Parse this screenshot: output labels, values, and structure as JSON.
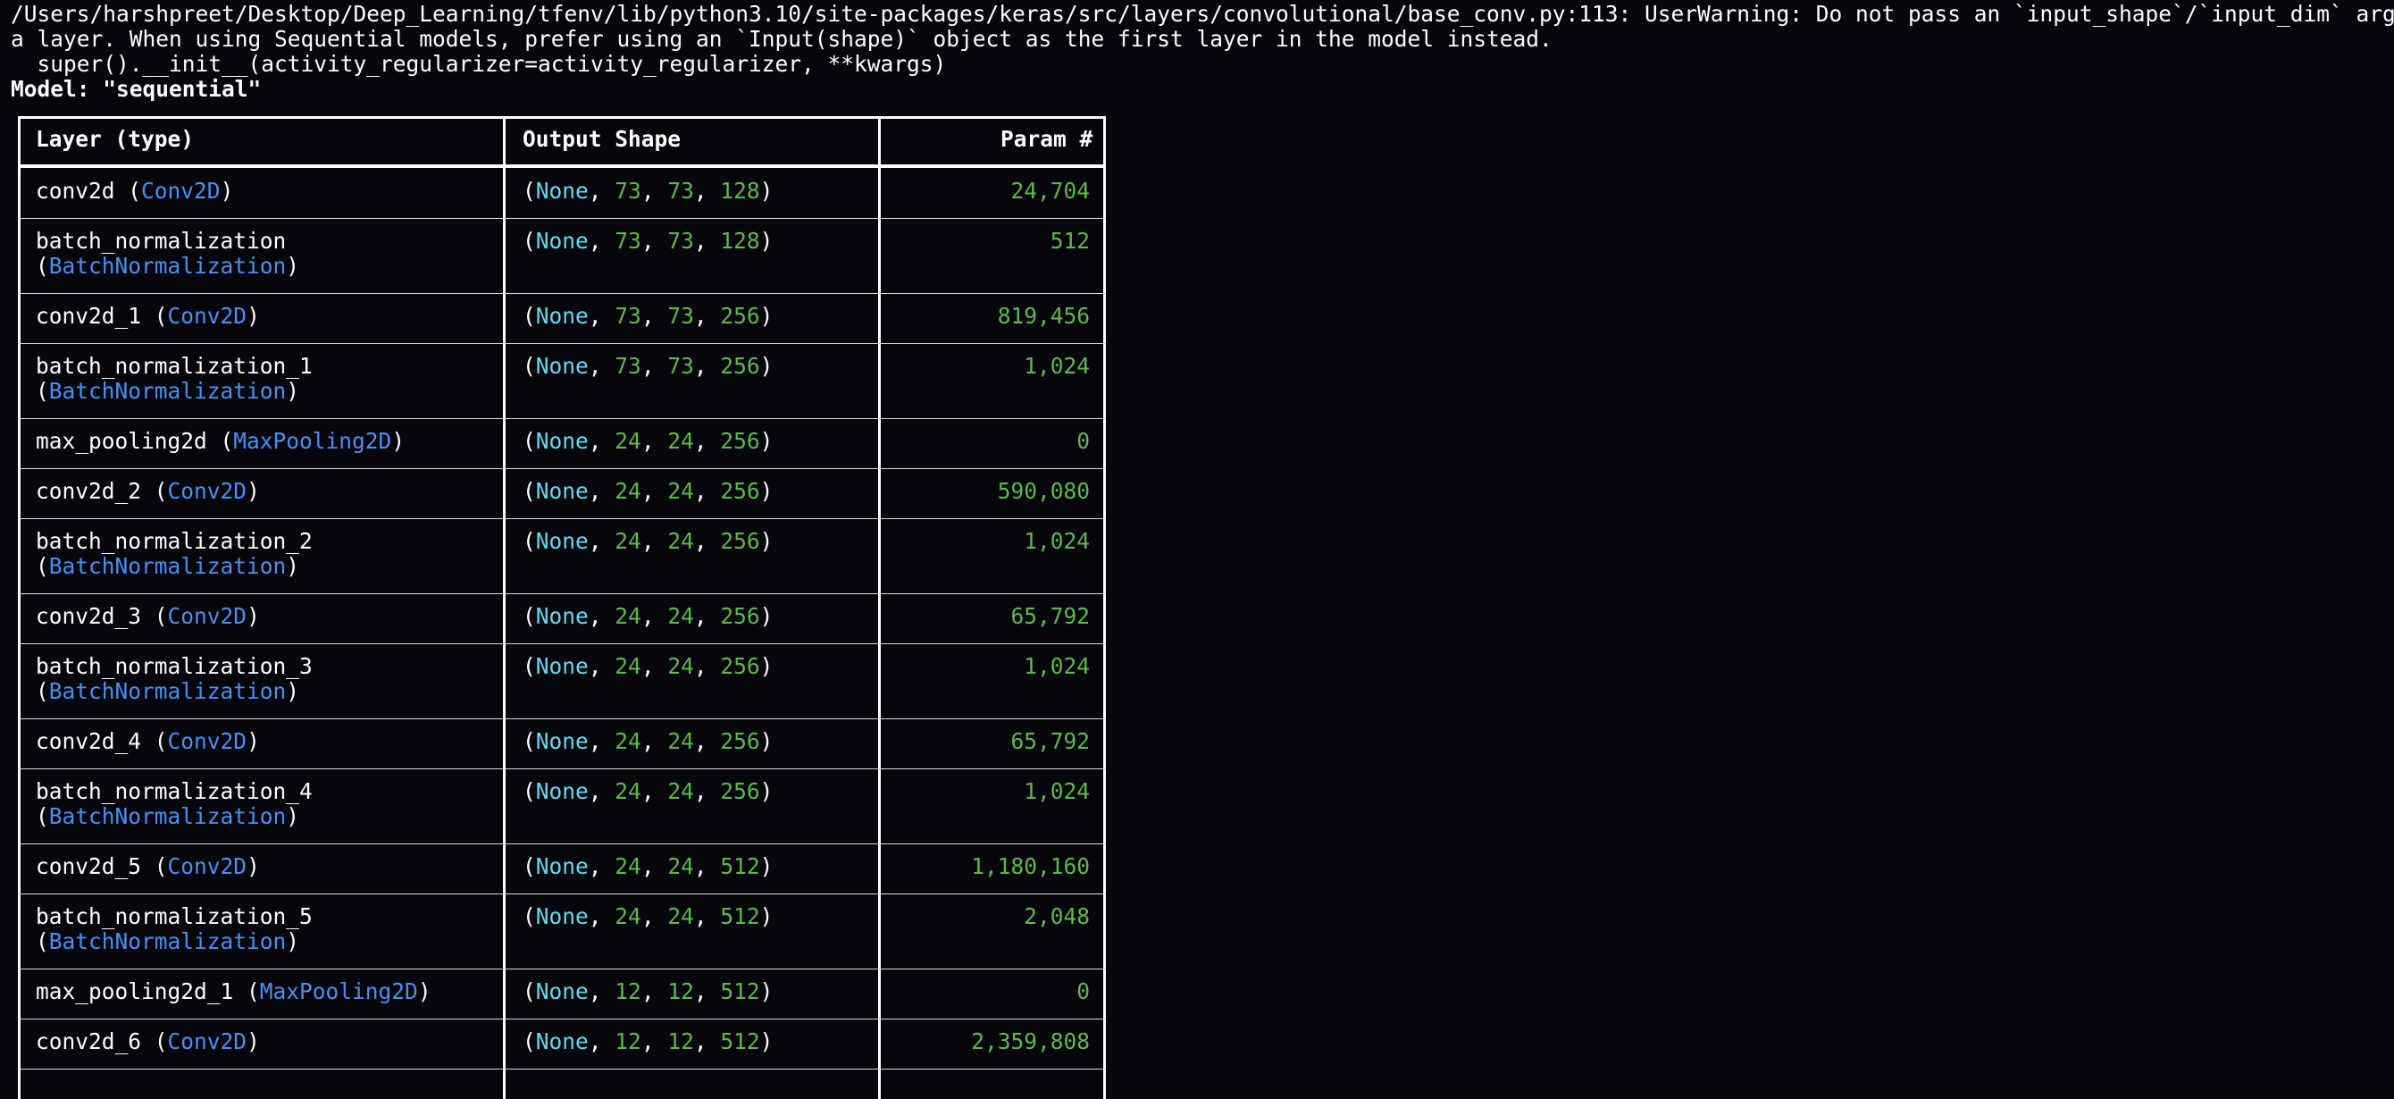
{
  "terminal": {
    "warning_lines": [
      "/Users/harshpreet/Desktop/Deep_Learning/tfenv/lib/python3.10/site-packages/keras/src/layers/convolutional/base_conv.py:113: UserWarning: Do not pass an `input_shape`/`input_dim` argument to",
      "a layer. When using Sequential models, prefer using an `Input(shape)` object as the first layer in the model instead.",
      "  super().__init__(activity_regularizer=activity_regularizer, **kwargs)"
    ],
    "model_title": "Model: \"sequential\""
  },
  "table": {
    "headers": {
      "layer": "Layer (type)",
      "shape": "Output Shape",
      "params": "Param #"
    },
    "rows": [
      {
        "name": "conv2d",
        "type": "Conv2D",
        "two_line": false,
        "shape": [
          "None",
          "73",
          "73",
          "128"
        ],
        "params": "24,704"
      },
      {
        "name": "batch_normalization",
        "type": "BatchNormalization",
        "two_line": true,
        "shape": [
          "None",
          "73",
          "73",
          "128"
        ],
        "params": "512"
      },
      {
        "name": "conv2d_1",
        "type": "Conv2D",
        "two_line": false,
        "shape": [
          "None",
          "73",
          "73",
          "256"
        ],
        "params": "819,456"
      },
      {
        "name": "batch_normalization_1",
        "type": "BatchNormalization",
        "two_line": true,
        "shape": [
          "None",
          "73",
          "73",
          "256"
        ],
        "params": "1,024"
      },
      {
        "name": "max_pooling2d",
        "type": "MaxPooling2D",
        "two_line": false,
        "shape": [
          "None",
          "24",
          "24",
          "256"
        ],
        "params": "0"
      },
      {
        "name": "conv2d_2",
        "type": "Conv2D",
        "two_line": false,
        "shape": [
          "None",
          "24",
          "24",
          "256"
        ],
        "params": "590,080"
      },
      {
        "name": "batch_normalization_2",
        "type": "BatchNormalization",
        "two_line": true,
        "shape": [
          "None",
          "24",
          "24",
          "256"
        ],
        "params": "1,024"
      },
      {
        "name": "conv2d_3",
        "type": "Conv2D",
        "two_line": false,
        "shape": [
          "None",
          "24",
          "24",
          "256"
        ],
        "params": "65,792"
      },
      {
        "name": "batch_normalization_3",
        "type": "BatchNormalization",
        "two_line": true,
        "shape": [
          "None",
          "24",
          "24",
          "256"
        ],
        "params": "1,024"
      },
      {
        "name": "conv2d_4",
        "type": "Conv2D",
        "two_line": false,
        "shape": [
          "None",
          "24",
          "24",
          "256"
        ],
        "params": "65,792"
      },
      {
        "name": "batch_normalization_4",
        "type": "BatchNormalization",
        "two_line": true,
        "shape": [
          "None",
          "24",
          "24",
          "256"
        ],
        "params": "1,024"
      },
      {
        "name": "conv2d_5",
        "type": "Conv2D",
        "two_line": false,
        "shape": [
          "None",
          "24",
          "24",
          "512"
        ],
        "params": "1,180,160"
      },
      {
        "name": "batch_normalization_5",
        "type": "BatchNormalization",
        "two_line": true,
        "shape": [
          "None",
          "24",
          "24",
          "512"
        ],
        "params": "2,048"
      },
      {
        "name": "max_pooling2d_1",
        "type": "MaxPooling2D",
        "two_line": false,
        "shape": [
          "None",
          "12",
          "12",
          "512"
        ],
        "params": "0"
      },
      {
        "name": "conv2d_6",
        "type": "Conv2D",
        "two_line": false,
        "shape": [
          "None",
          "12",
          "12",
          "512"
        ],
        "params": "2,359,808"
      }
    ]
  },
  "colors": {
    "background": "#05070c",
    "text": "#ffffff",
    "layer_type": "#4d8ff0",
    "none_value": "#66d9ef",
    "number": "#5fb84a"
  }
}
